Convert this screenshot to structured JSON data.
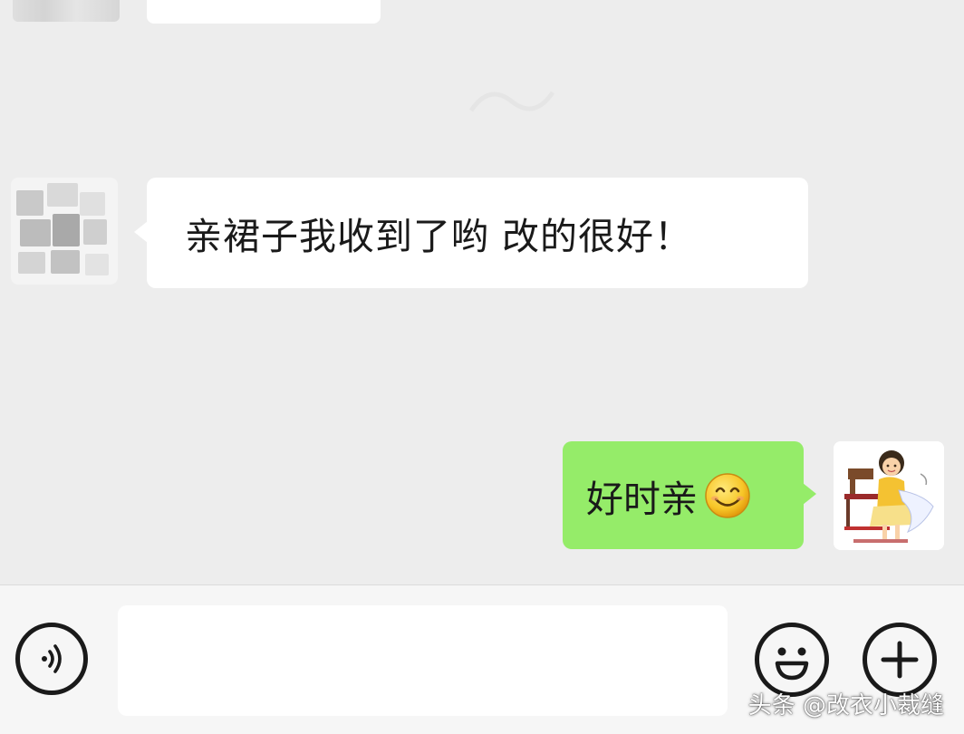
{
  "chat": {
    "incoming_message": {
      "text": "亲裙子我收到了哟 改的很好！",
      "avatar_icon": "blurred-avatar-icon"
    },
    "outgoing_message": {
      "text": "好时亲",
      "emoji": "smile-emoji-icon",
      "avatar_icon": "seamstress-avatar-icon"
    }
  },
  "input_bar": {
    "voice_icon": "voice-icon",
    "input_value": "",
    "emoji_icon": "emoji-face-icon",
    "plus_icon": "plus-icon"
  },
  "watermark": {
    "text": "头条 @改衣小裁缝"
  },
  "colors": {
    "background": "#ededed",
    "incoming_bubble": "#ffffff",
    "outgoing_bubble": "#95ec69",
    "input_bar": "#f6f6f6"
  }
}
